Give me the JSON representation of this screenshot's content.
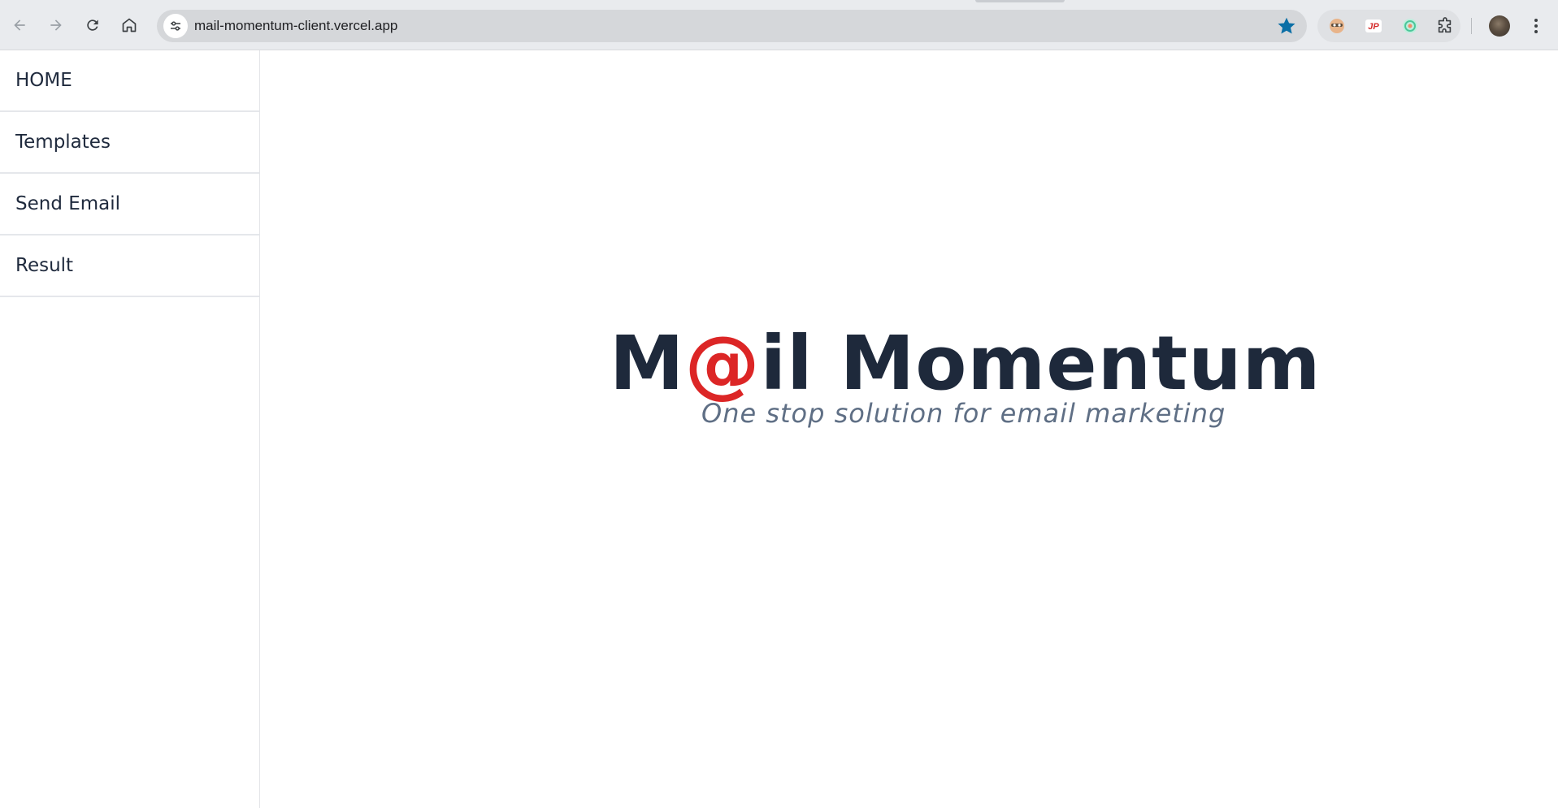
{
  "browser": {
    "url": "mail-momentum-client.vercel.app",
    "icons": {
      "back": "arrow-left-icon",
      "forward": "arrow-right-icon",
      "reload": "reload-icon",
      "home": "home-icon",
      "site_info": "tune-icon",
      "bookmark": "star-icon",
      "extensions": "puzzle-icon",
      "menu": "kebab-menu-icon"
    },
    "colors": {
      "bookmark_star": "#0b6fa6"
    }
  },
  "sidebar": {
    "items": [
      {
        "label": "HOME"
      },
      {
        "label": "Templates"
      },
      {
        "label": "Send Email"
      },
      {
        "label": "Result"
      }
    ]
  },
  "main": {
    "logo": {
      "part1": "M",
      "at": "@",
      "part2": "il Momentum"
    },
    "tagline": "One stop solution for email marketing",
    "colors": {
      "title": "#1e293b",
      "accent": "#dc2626",
      "tagline": "#5f6f85"
    }
  }
}
